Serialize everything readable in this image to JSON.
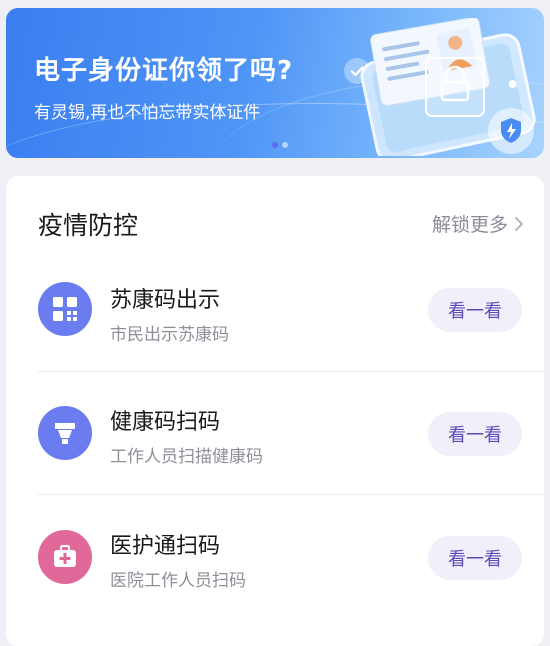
{
  "banner": {
    "title": "电子身份证你领了吗?",
    "subtitle": "有灵锡,再也不怕忘带实体证件",
    "colors": {
      "gradient_start": "#3a7ef0",
      "gradient_end": "#a8d3fd"
    },
    "icons": [
      "check-icon",
      "id-card-illustration",
      "shield-bolt-icon"
    ],
    "carousel": {
      "total": 2,
      "active": 1
    }
  },
  "section": {
    "title": "疫情防控",
    "more_label": "解锁更多",
    "more_icon": "chevron-right-icon"
  },
  "items": [
    {
      "title": "苏康码出示",
      "subtitle": "市民出示苏康码",
      "button": "看一看",
      "icon": "qr-code-icon",
      "icon_color": "#6b7cf0"
    },
    {
      "title": "健康码扫码",
      "subtitle": "工作人员扫描健康码",
      "button": "看一看",
      "icon": "scanner-icon",
      "icon_color": "#6b7cf0"
    },
    {
      "title": "医护通扫码",
      "subtitle": "医院工作人员扫码",
      "button": "看一看",
      "icon": "medical-kit-icon",
      "icon_color": "#e2689a"
    }
  ],
  "accent": {
    "button_bg": "#f0effa",
    "button_text": "#5e4bb6"
  }
}
